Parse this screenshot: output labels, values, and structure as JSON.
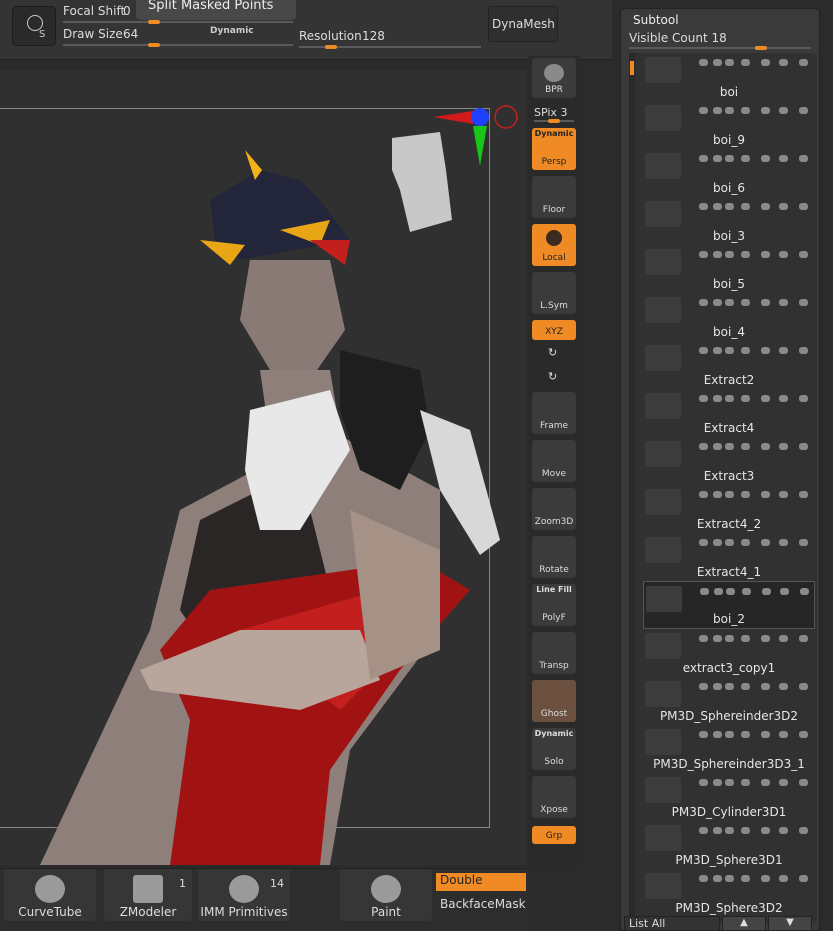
{
  "topbar": {
    "focal_shift_label": "Focal Shift",
    "focal_shift_value": "0",
    "draw_size_label": "Draw Size",
    "draw_size_value": "64",
    "dynamic_label": "Dynamic",
    "resolution_label": "Resolution",
    "resolution_value": "128",
    "tooltip": "Split Masked Points",
    "dynamesh_label": "DynaMesh"
  },
  "shelf": {
    "bpr": "BPR",
    "spix_label": "SPix",
    "spix_value": "3",
    "persp_dynamic": "Dynamic",
    "persp": "Persp",
    "floor": "Floor",
    "local": "Local",
    "lsym": "L.Sym",
    "xyz": "XYZ",
    "frame": "Frame",
    "move": "Move",
    "zoom3d": "Zoom3D",
    "rotate": "Rotate",
    "linefill": "Line Fill",
    "polyf": "PolyF",
    "transp": "Transp",
    "ghost": "Ghost",
    "solo_dynamic": "Dynamic",
    "solo": "Solo",
    "xpose": "Xpose",
    "grp": "Grp"
  },
  "bottom": {
    "curvetube": "CurveTube",
    "zmodeler": "ZModeler",
    "zmodeler_count": "1",
    "imm": "IMM Primitives",
    "imm_count": "14",
    "paint": "Paint",
    "double": "Double",
    "backfacemask": "BackfaceMask"
  },
  "subtool": {
    "title": "Subtool",
    "visible_count_label": "Visible Count",
    "visible_count_value": "18",
    "items": [
      {
        "name": "boi"
      },
      {
        "name": "boi_9"
      },
      {
        "name": "boi_6"
      },
      {
        "name": "boi_3"
      },
      {
        "name": "boi_5"
      },
      {
        "name": "boi_4"
      },
      {
        "name": "Extract2"
      },
      {
        "name": "Extract4"
      },
      {
        "name": "Extract3"
      },
      {
        "name": "Extract4_2"
      },
      {
        "name": "Extract4_1"
      },
      {
        "name": "boi_2"
      },
      {
        "name": "extract3_copy1"
      },
      {
        "name": "PM3D_Sphereinder3D2"
      },
      {
        "name": "PM3D_Sphereinder3D3_1"
      },
      {
        "name": "PM3D_Cylinder3D1"
      },
      {
        "name": "PM3D_Sphere3D1"
      },
      {
        "name": "PM3D_Sphere3D2"
      }
    ],
    "list_all": "List All"
  },
  "colors": {
    "accent": "#f08a24"
  }
}
